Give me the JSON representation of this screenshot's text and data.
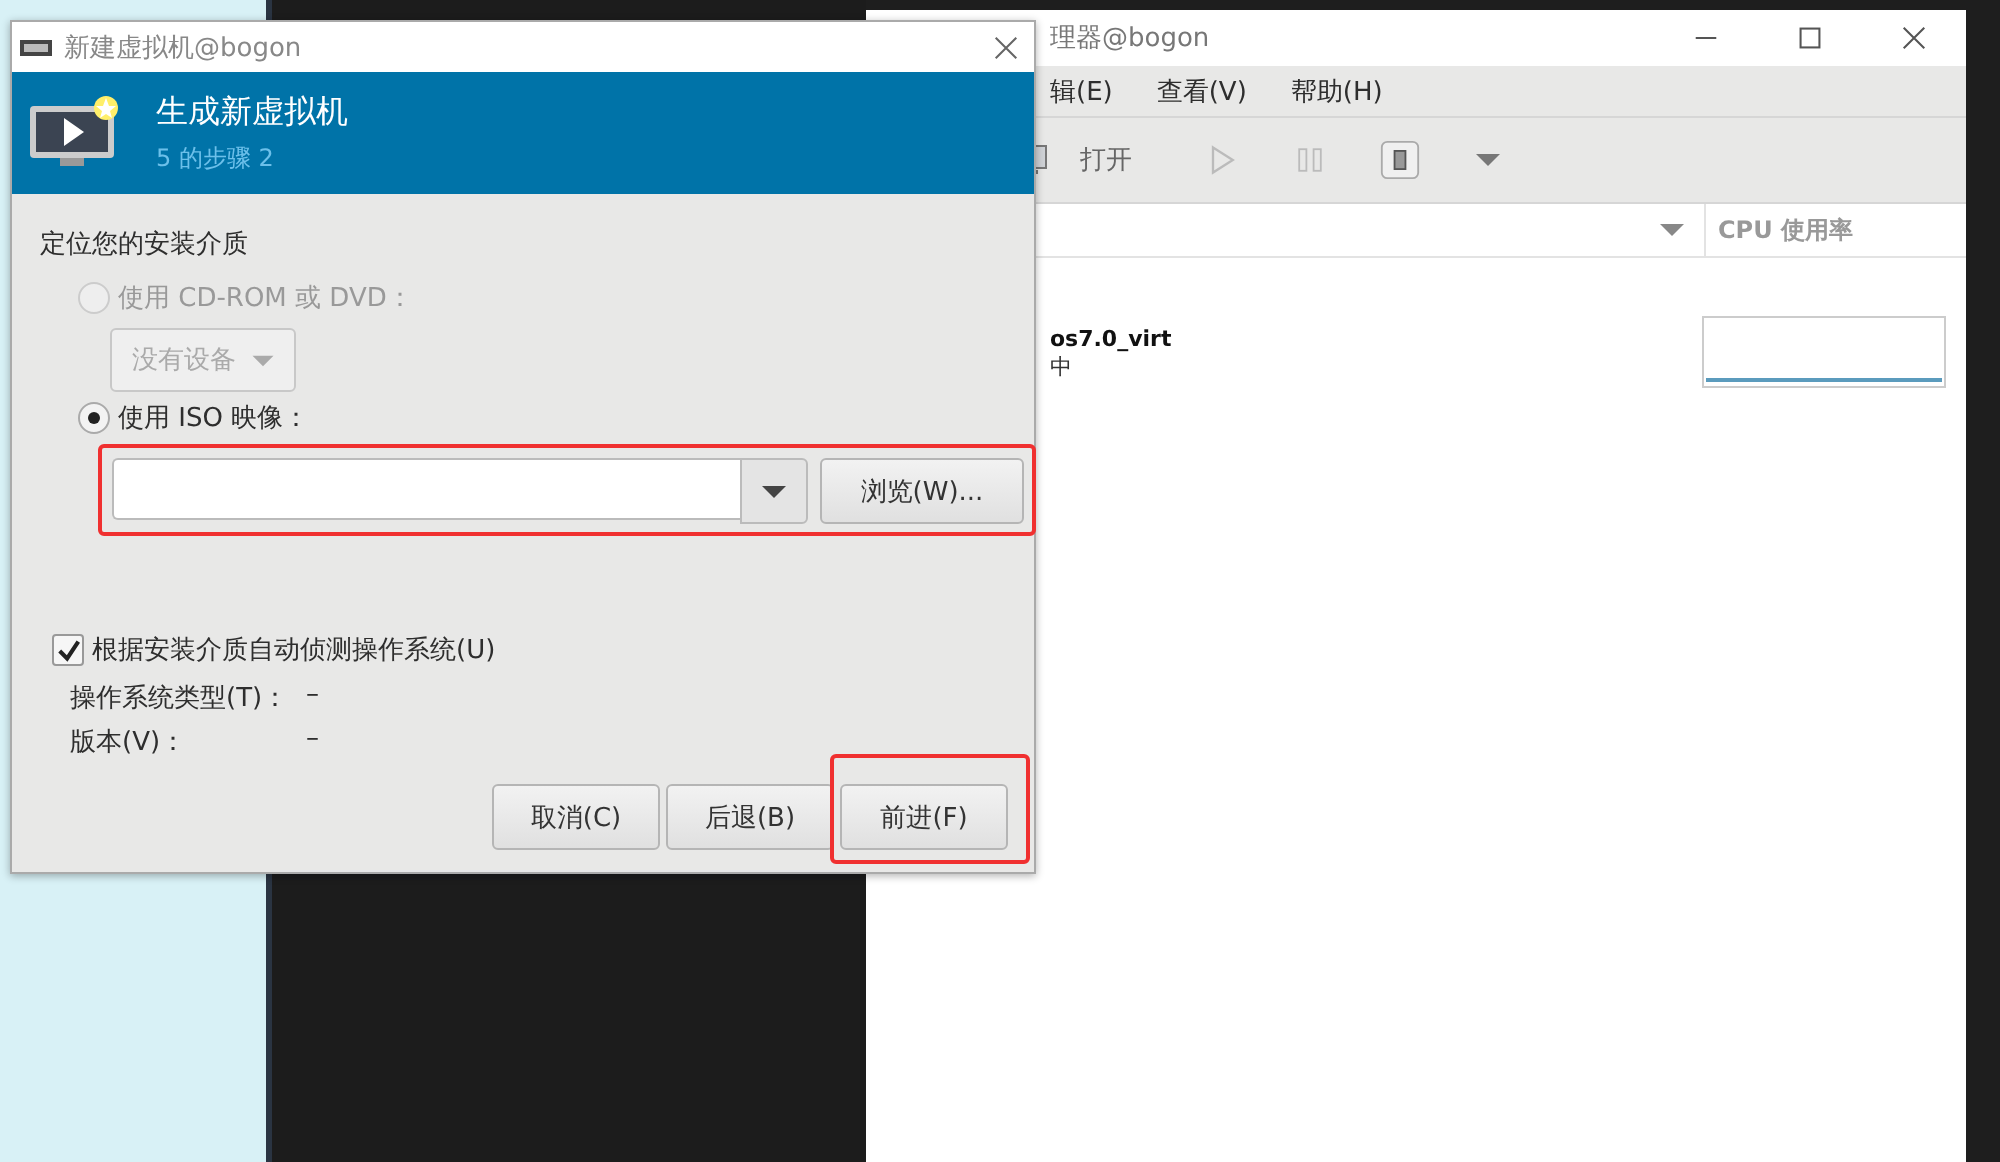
{
  "manager_window": {
    "title": "理器@bogon",
    "menu": [
      "辑(E)",
      "查看(V)",
      "帮助(H)"
    ],
    "open_label": "打开",
    "column": "CPU 使用率",
    "vms": [
      {
        "name": "os7.0_virt",
        "status": "中"
      }
    ]
  },
  "dialog": {
    "title": "新建虚拟机@bogon",
    "heading": "生成新虚拟机",
    "step": "5 的步骤 2",
    "section": "定位您的安装介质",
    "media_options": [
      {
        "kind": "cdrom",
        "label": "使用  CD-ROM 或  DVD：",
        "selected": false,
        "disabled": true,
        "device": "没有设备"
      },
      {
        "kind": "iso",
        "label": "使用  ISO 映像：",
        "selected": true,
        "disabled": false,
        "browse": "浏览(W)...",
        "highlighted": true
      }
    ],
    "autodetect": {
      "label": "根据安装介质自动侦测操作系统(U)",
      "checked": true
    },
    "details": [
      {
        "label": "操作系统类型(T)：",
        "value": "–"
      },
      {
        "label": "版本(V)：",
        "value": "–"
      }
    ],
    "buttons": [
      {
        "label": "取消(C)",
        "highlighted": false
      },
      {
        "label": "后退(B)",
        "highlighted": false
      },
      {
        "label": "前进(F)",
        "highlighted": true
      }
    ]
  }
}
